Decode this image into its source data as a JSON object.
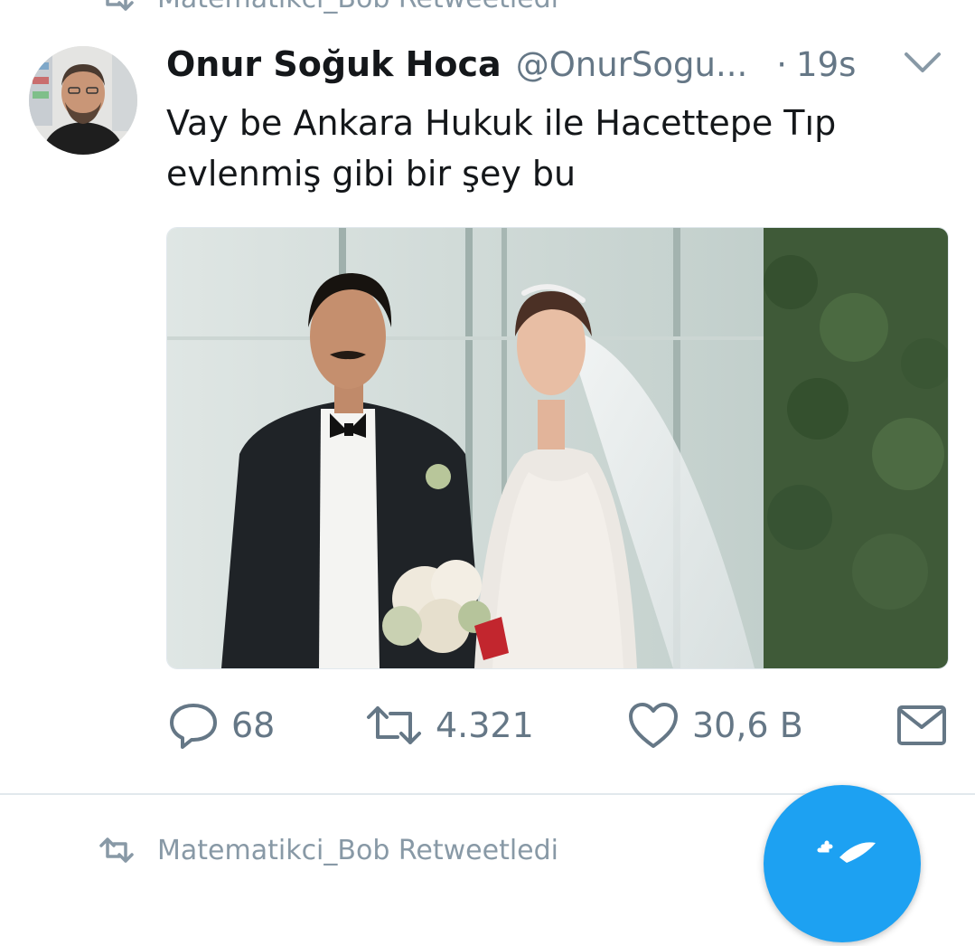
{
  "retweet_context_top": {
    "text": "Matematikci_Bob Retweetledi"
  },
  "tweet": {
    "author_name": "Onur Soğuk Hoca",
    "author_handle": "@OnurSogu...",
    "separator": "·",
    "timestamp": "19s",
    "text": "Vay be Ankara Hukuk ile Hacettepe Tıp evlenmiş gibi bir şey bu",
    "media": {
      "kind": "photo"
    },
    "actions": {
      "reply_count": "68",
      "retweet_count": "4.321",
      "like_count": "30,6 B"
    }
  },
  "retweet_context_bottom": {
    "text": "Matematikci_Bob Retweetledi"
  },
  "icons": {
    "reply": "speech-bubble-icon",
    "retweet": "retweet-arrows-icon",
    "like": "heart-icon",
    "dm": "envelope-icon",
    "menu": "chevron-down-icon",
    "compose": "compose-tweet-icon"
  },
  "colors": {
    "accent": "#1da1f2",
    "text_primary": "#14171a",
    "text_secondary": "#657786",
    "divider": "#e1e8ed"
  }
}
